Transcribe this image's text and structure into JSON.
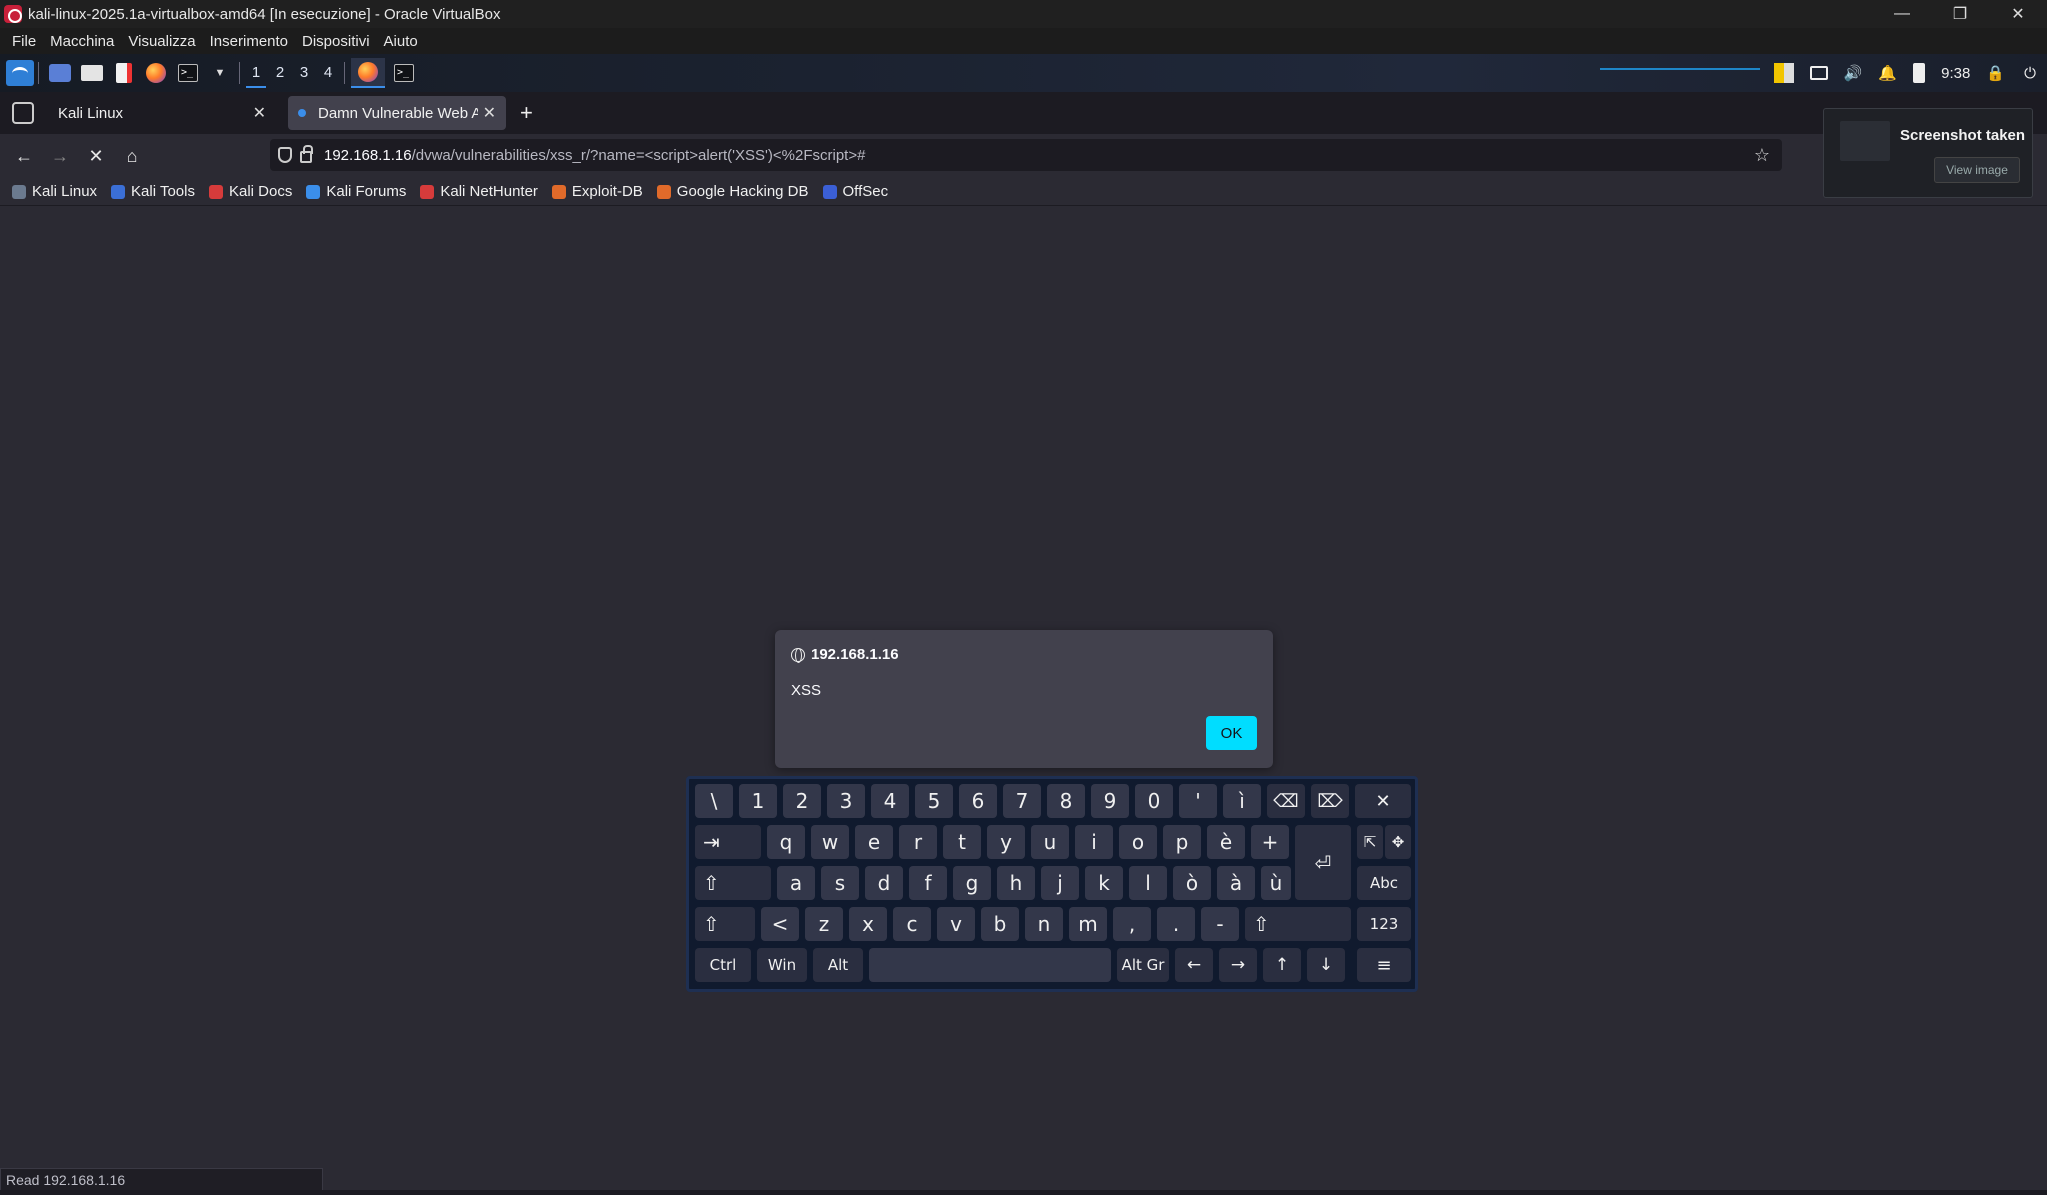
{
  "window": {
    "title": "kali-linux-2025.1a-virtualbox-amd64 [In esecuzione] - Oracle VirtualBox",
    "controls": {
      "minimize": "—",
      "restore": "❐",
      "close": "✕"
    }
  },
  "vbox_menu": [
    "File",
    "Macchina",
    "Visualizza",
    "Inserimento",
    "Dispositivi",
    "Aiuto"
  ],
  "panel": {
    "workspaces": [
      "1",
      "2",
      "3",
      "4"
    ],
    "active_workspace": "1",
    "clock": "9:38"
  },
  "tabs": [
    {
      "title": "Kali Linux",
      "active": false
    },
    {
      "title": "Damn Vulnerable Web Ap",
      "active": true
    }
  ],
  "newtab_label": "+",
  "url": {
    "domain": "192.168.1.16",
    "path": "/dvwa/vulnerabilities/xss_r/?name=<script>alert('XSS')<%2Fscript>#"
  },
  "bookmarks": [
    {
      "label": "Kali Linux",
      "color": "#6b7a8f"
    },
    {
      "label": "Kali Tools",
      "color": "#3b6fd6"
    },
    {
      "label": "Kali Docs",
      "color": "#d63b3b"
    },
    {
      "label": "Kali Forums",
      "color": "#3b8eea"
    },
    {
      "label": "Kali NetHunter",
      "color": "#d63b3b"
    },
    {
      "label": "Exploit-DB",
      "color": "#e06a2a"
    },
    {
      "label": "Google Hacking DB",
      "color": "#e06a2a"
    },
    {
      "label": "OffSec",
      "color": "#3b5fd6"
    }
  ],
  "notification": {
    "title": "Screenshot taken",
    "button": "View image"
  },
  "alert": {
    "origin": "192.168.1.16",
    "message": "XSS",
    "ok": "OK"
  },
  "keyboard": {
    "row1": [
      "\\",
      "1",
      "2",
      "3",
      "4",
      "5",
      "6",
      "7",
      "8",
      "9",
      "0",
      "'",
      "ì"
    ],
    "row2": [
      "q",
      "w",
      "e",
      "r",
      "t",
      "y",
      "u",
      "i",
      "o",
      "p",
      "è",
      "+"
    ],
    "row3": [
      "a",
      "s",
      "d",
      "f",
      "g",
      "h",
      "j",
      "k",
      "l",
      "ò",
      "à",
      "ù"
    ],
    "row4": [
      "<",
      "z",
      "x",
      "c",
      "v",
      "b",
      "n",
      "m",
      ",",
      ".",
      "-"
    ],
    "mods": {
      "tab": "⇥",
      "shift": "⇧",
      "enter": "⏎",
      "backspace": "⌫",
      "delete": "⌦",
      "close": "✕",
      "abc": "Abc",
      "num": "123",
      "ctrl": "Ctrl",
      "win": "Win",
      "alt": "Alt",
      "altgr": "Alt Gr",
      "left": "←",
      "right": "→",
      "up": "↑",
      "down": "↓",
      "menu": "≡"
    }
  },
  "status": "Read 192.168.1.16",
  "accent": "#00ddff"
}
